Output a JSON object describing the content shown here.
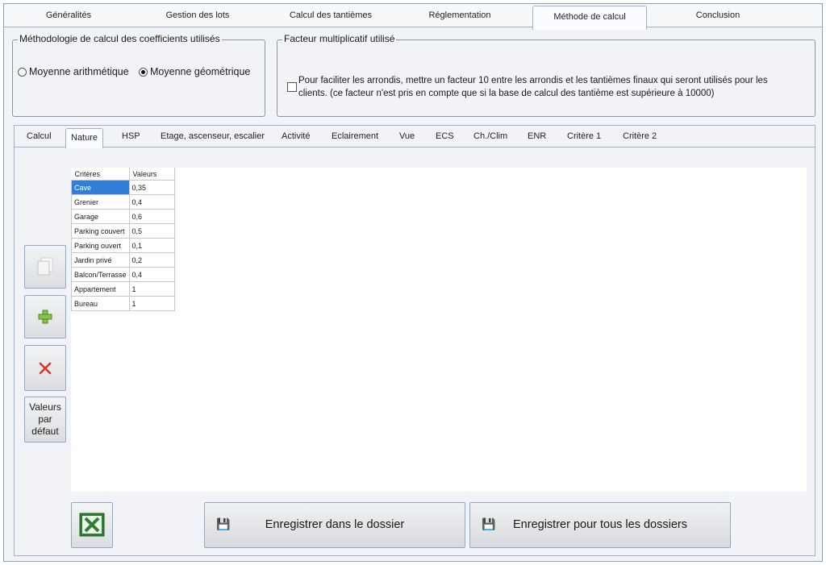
{
  "top_tabs": [
    "Généralités",
    "Gestion des lots",
    "Calcul des tantièmes",
    "Réglementation",
    "Méthode de calcul",
    "Conclusion"
  ],
  "top_tabs_active": "Méthode de calcul",
  "methodo": {
    "title": "Méthodologie de calcul des coefficients utilisés",
    "option1": "Moyenne arithmétique",
    "option2": "Moyenne géométrique",
    "selected": "Moyenne géométrique"
  },
  "facteur": {
    "title": "Facteur multiplicatif utilisé",
    "text": "Pour faciliter les arrondis, mettre un facteur 10 entre les arrondis et les tantièmes finaux qui seront utilisés pour les clients. (ce facteur n'est pris en compte que si la base de calcul des tantième est supérieure à 10000)",
    "checked": false
  },
  "sub_tabs": [
    "Calcul",
    "Nature",
    "HSP",
    "Etage, ascenseur, escalier",
    "Activité",
    "Eclairement",
    "Vue",
    "ECS",
    "Ch./Clim",
    "ENR",
    "Critère 1",
    "Critère 2"
  ],
  "sub_tabs_active": "Nature",
  "table": {
    "headers": [
      "Critères",
      "Valeurs"
    ],
    "rows": [
      [
        "Cave",
        "0,35"
      ],
      [
        "Grenier",
        "0,4"
      ],
      [
        "Garage",
        "0,6"
      ],
      [
        "Parking couvert",
        "0,5"
      ],
      [
        "Parking ouvert",
        "0,1"
      ],
      [
        "Jardin privé",
        "0,2"
      ],
      [
        "Balcon/Terrasse",
        "0,4"
      ],
      [
        "Appartement",
        "1"
      ],
      [
        "Bureau",
        "1"
      ]
    ],
    "selected_row": 0
  },
  "buttons": {
    "defaults": "Valeurs par défaut",
    "save_folder": "Enregistrer dans le dossier",
    "save_all": "Enregistrer pour tous les dossiers"
  },
  "icons": {
    "copy": "copy-icon",
    "add": "plus-icon",
    "delete": "delete-icon",
    "excel": "excel-icon",
    "save": "floppy-icon"
  }
}
